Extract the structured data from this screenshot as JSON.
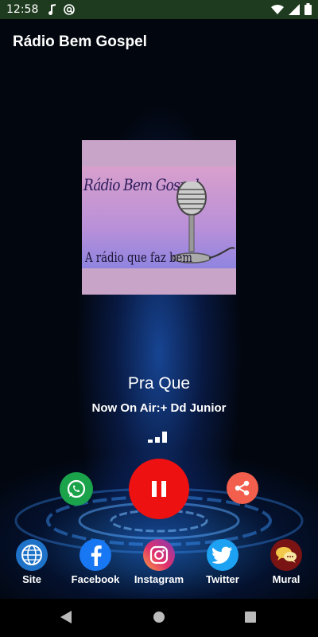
{
  "status_bar": {
    "time": "12:58",
    "left_icons": [
      "music-note-icon",
      "podcast-icon"
    ],
    "right_icons": [
      "wifi-icon",
      "signal-icon",
      "battery-icon"
    ]
  },
  "app": {
    "title": "Rádio Bem Gospel"
  },
  "cover": {
    "line1": "Rádio Bem Gospel",
    "line2": "A rádio que faz bem"
  },
  "player": {
    "song_title": "Pra Que",
    "now_on_air": "Now On Air:+ Dd Junior",
    "state": "playing"
  },
  "actions": {
    "whatsapp_icon": "whatsapp-icon",
    "pause_icon": "pause-icon",
    "share_icon": "share-icon"
  },
  "links": [
    {
      "label": "Site",
      "icon": "globe-icon",
      "color": "#1e73c8"
    },
    {
      "label": "Facebook",
      "icon": "facebook-icon",
      "color": "#1877f2"
    },
    {
      "label": "Instagram",
      "icon": "instagram-icon",
      "color": "#d6249f"
    },
    {
      "label": "Twitter",
      "icon": "twitter-icon",
      "color": "#1da1f2"
    },
    {
      "label": "Mural",
      "icon": "chat-bubbles-icon",
      "color": "#8b1a1a"
    }
  ],
  "colors": {
    "status_bar": "#1f3b1f",
    "pause_button": "#ee1111",
    "whatsapp": "#1aa34a",
    "share": "#f25f4c"
  }
}
